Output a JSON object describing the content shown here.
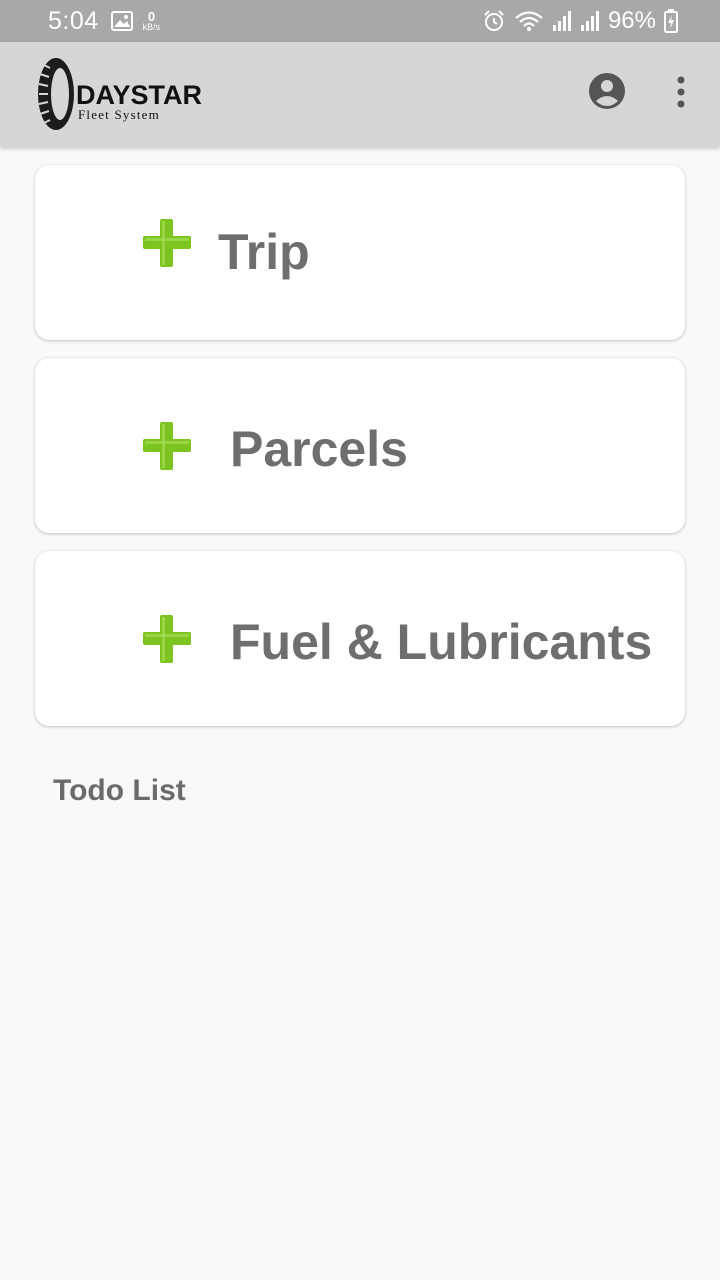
{
  "status_bar": {
    "time": "5:04",
    "net_speed_value": "0",
    "net_speed_unit": "kB/s",
    "battery": "96%",
    "icons": [
      "gallery-icon",
      "alarm-icon",
      "wifi-icon",
      "signal-icon",
      "signal-icon",
      "battery-charging-icon"
    ]
  },
  "app_bar": {
    "logo_title": "DAYSTAR",
    "logo_subtitle": "Fleet System",
    "actions": [
      "account-circle-icon",
      "more-vert-icon"
    ]
  },
  "cards": [
    {
      "label": "Trip",
      "icon": "plus-icon"
    },
    {
      "label": "Parcels",
      "icon": "plus-icon"
    },
    {
      "label": "Fuel & Lubricants",
      "icon": "plus-icon"
    }
  ],
  "todo": {
    "title": "Todo List"
  },
  "colors": {
    "status_bar": "#a8a8a8",
    "app_bar": "#d6d6d6",
    "plus_green": "#7cc41f",
    "card_text": "#6e6e6e",
    "background": "#f9f9f9"
  }
}
